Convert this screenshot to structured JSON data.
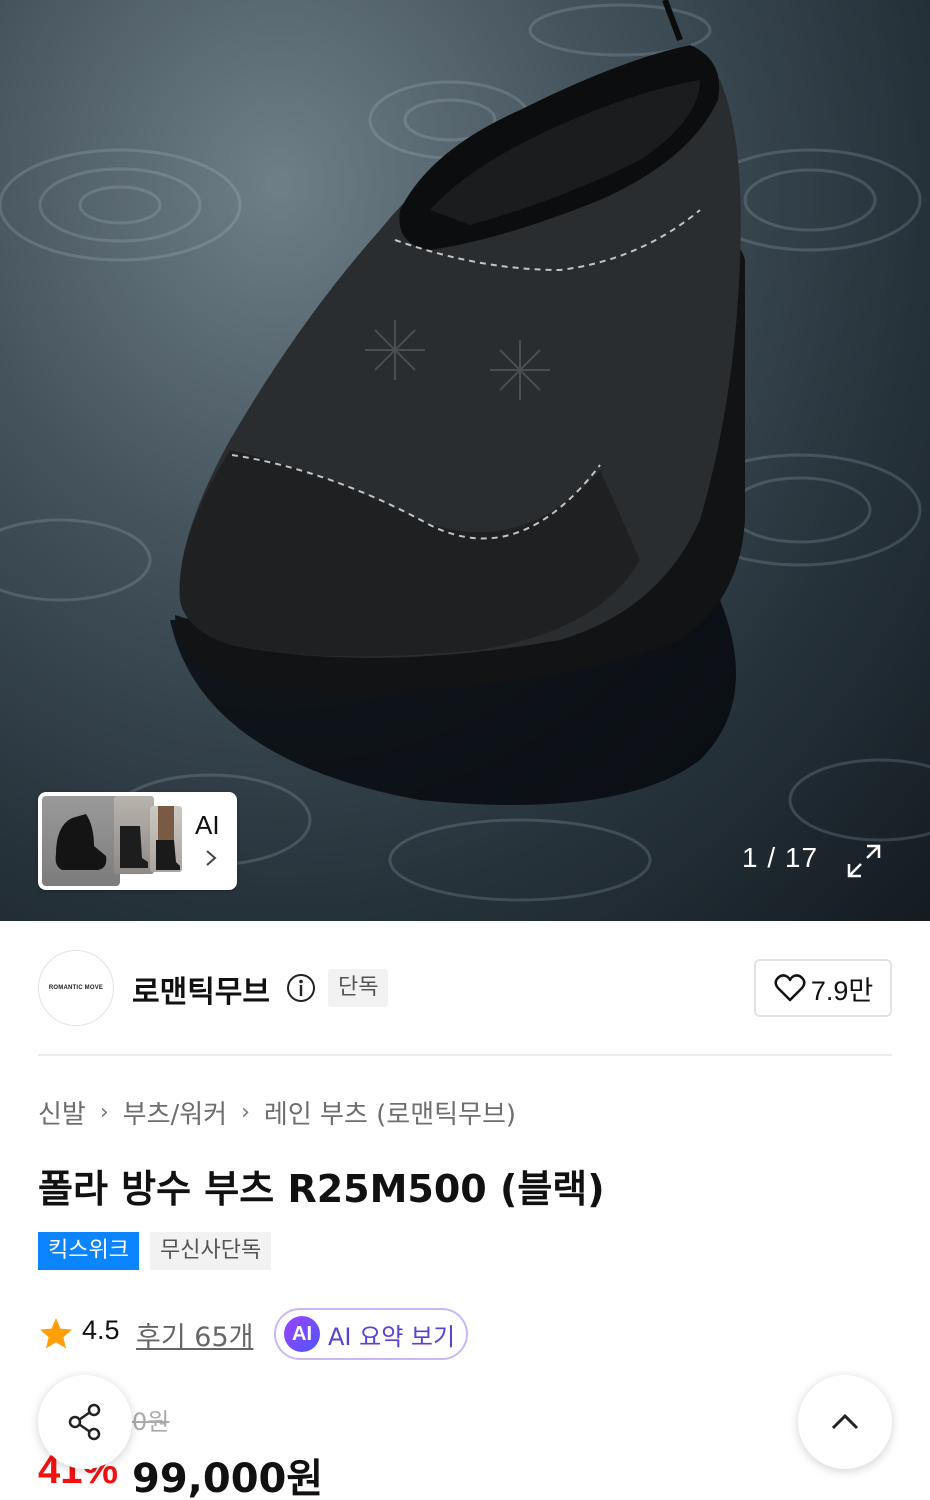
{
  "gallery": {
    "thumbnail_label": "AI",
    "counter": "1 / 17"
  },
  "brand": {
    "logo_text": "ROMANTIC MOVE",
    "name": "로맨틱무브",
    "exclusive_tag": "단독",
    "like_count": "7.9만"
  },
  "breadcrumb": [
    "신발",
    "부츠/워커",
    "레인 부츠 (로맨틱무브)"
  ],
  "product": {
    "title": "폴라 방수 부츠 R25M500 (블랙)",
    "tags": [
      "킥스위크",
      "무신사단독"
    ],
    "rating": "4.5",
    "reviews_label": "후기 65개",
    "ai_badge": "AI",
    "ai_summary_label": "AI 요약 보기",
    "original_price": "0원",
    "discount": "41%",
    "price": "99,000원"
  },
  "colors": {
    "accent_blue": "#0a84ff",
    "discount_red": "#f31110",
    "ai_purple": "#5b3fd6",
    "star": "#ff9f0a"
  }
}
